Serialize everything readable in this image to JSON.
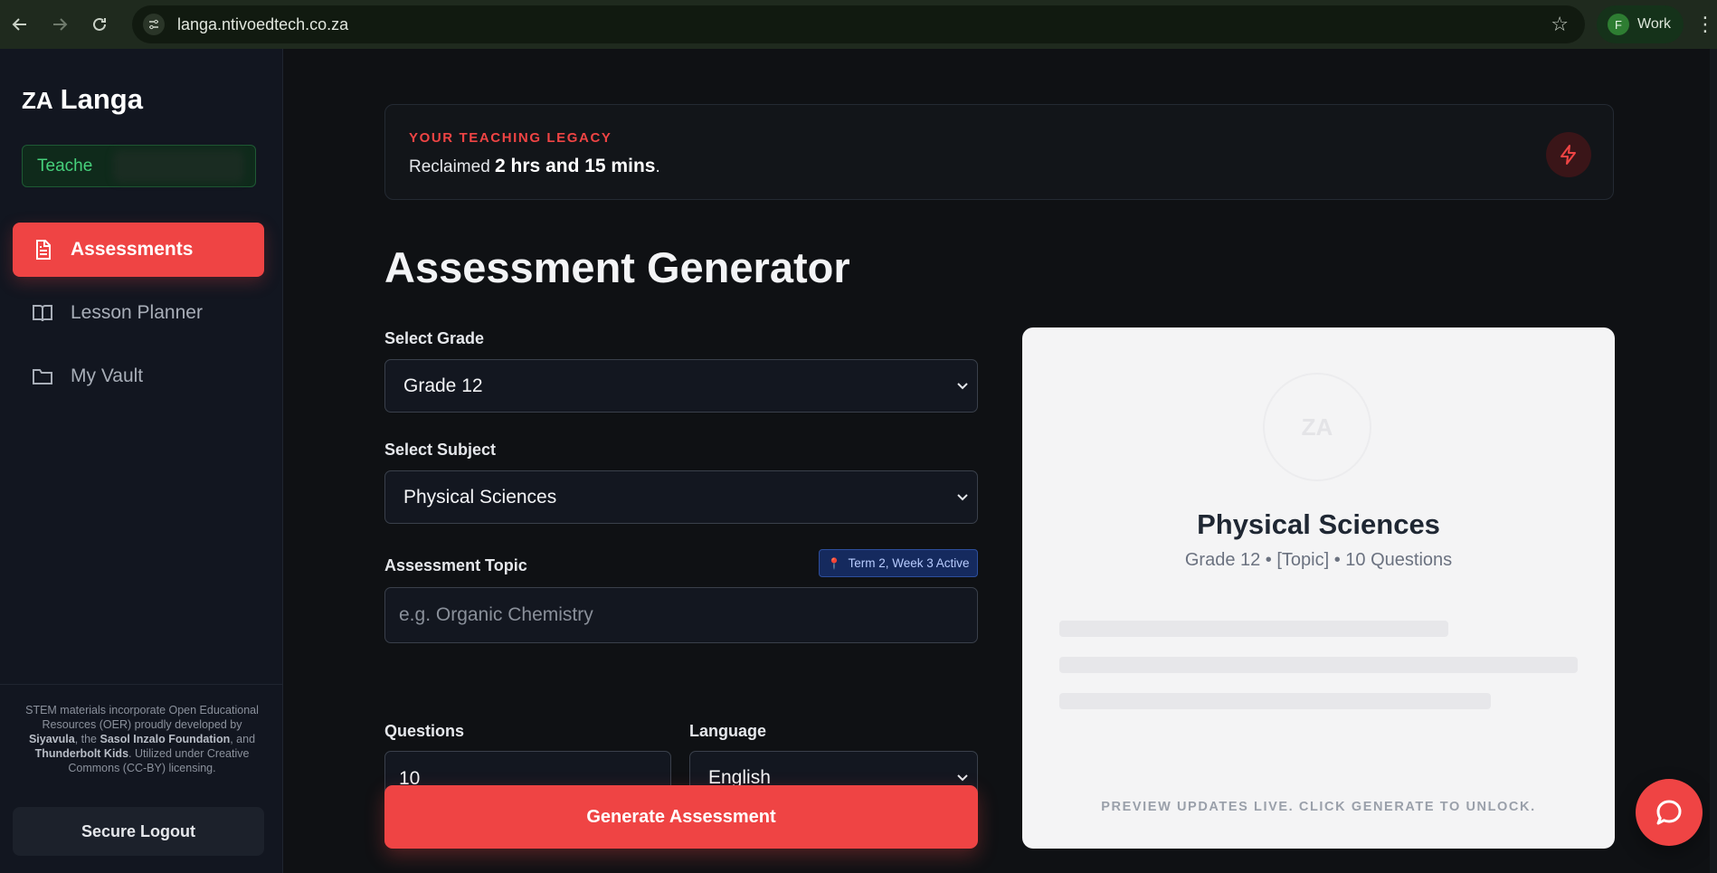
{
  "browser": {
    "url": "langa.ntivoedtech.co.za",
    "profile_initial": "F",
    "profile_name": "Work"
  },
  "sidebar": {
    "brand_flag": "ZA",
    "brand_name": "Langa",
    "teacher_label": "Teache",
    "items": [
      {
        "label": "Assessments",
        "icon": "document-icon",
        "active": true
      },
      {
        "label": "Lesson Planner",
        "icon": "book-icon",
        "active": false
      },
      {
        "label": "My Vault",
        "icon": "folder-icon",
        "active": false
      }
    ],
    "credits": {
      "part1": "STEM materials incorporate Open Educational Resources (OER) proudly developed by ",
      "org1": "Siyavula",
      "part2": ", the ",
      "org2": "Sasol Inzalo Foundation",
      "part3": ", and ",
      "org3": "Thunderbolt Kids",
      "part4": ". Utilized under Creative Commons (CC-BY) licensing."
    },
    "logout_label": "Secure Logout"
  },
  "legacy": {
    "kicker": "YOUR TEACHING LEGACY",
    "prefix": "Reclaimed",
    "amount": "2 hrs and 15 mins",
    "suffix": ".",
    "icon": "lightning-icon"
  },
  "form": {
    "title": "Assessment Generator",
    "grade_label": "Select Grade",
    "grade_value": "Grade 12",
    "subject_label": "Select Subject",
    "subject_value": "Physical Sciences",
    "topic_label": "Assessment Topic",
    "topic_badge": "Term 2, Week 3 Active",
    "topic_placeholder": "e.g. Organic Chemistry",
    "questions_label": "Questions",
    "questions_value": "10",
    "language_label": "Language",
    "language_value": "English",
    "generate_label": "Generate Assessment"
  },
  "preview": {
    "logo_text": "ZA",
    "title": "Physical Sciences",
    "meta": "Grade 12 • [Topic] • 10 Questions",
    "footer": "PREVIEW UPDATES LIVE. CLICK GENERATE TO UNLOCK."
  },
  "colors": {
    "accent": "#ef4444",
    "sidebar_bg": "#121620",
    "main_bg": "#0f1114",
    "teacher_green": "#46d07b"
  }
}
